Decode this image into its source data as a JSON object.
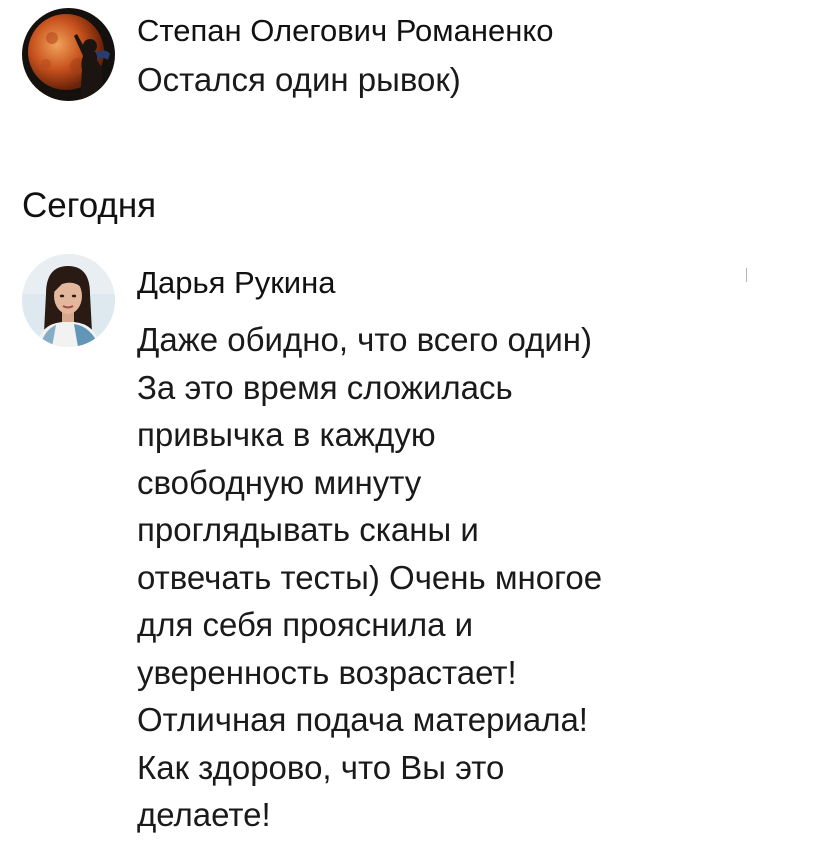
{
  "messages": [
    {
      "author": "Степан Олегович Романенко",
      "avatar": "avatar-moon-silhouette",
      "text": "Остался один рывок)"
    },
    {
      "author": "Дарья Рукина",
      "avatar": "avatar-woman-portrait",
      "text": "Даже обидно, что всего один)\nЗа это время сложилась\nпривычка в каждую\nсвободную минуту\nпроглядывать сканы и\nотвечать тесты) Очень многое\nдля себя прояснила и\nуверенность возрастает!\nОтличная подача  материала!\nКак здорово, что Вы это\nделаете!"
    }
  ],
  "date_separator": "Сегодня",
  "colors": {
    "background": "#ffffff",
    "text": "#1a1a1a",
    "moon": "#c8521e",
    "avatar2_bg": "#dde8ef"
  }
}
